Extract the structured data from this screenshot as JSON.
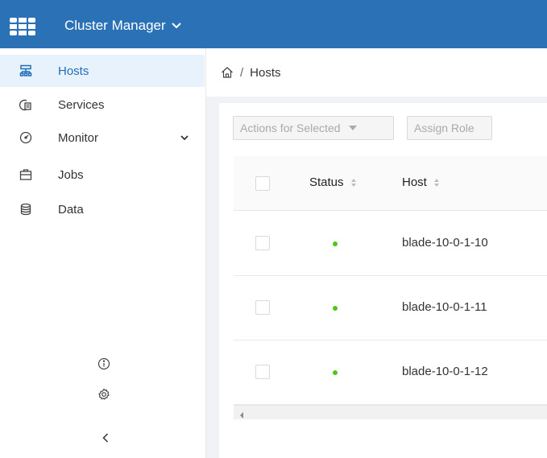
{
  "header": {
    "app_title": "Cluster Manager",
    "logo_icon": "grid-logo-icon",
    "bar_color": "#2a72b5"
  },
  "sidebar": {
    "items": [
      {
        "label": "Hosts",
        "icon": "hosts-icon",
        "active": true
      },
      {
        "label": "Services",
        "icon": "services-icon",
        "active": false
      },
      {
        "label": "Monitor",
        "icon": "monitor-icon",
        "active": false,
        "expandable": true
      },
      {
        "label": "Jobs",
        "icon": "jobs-icon",
        "active": false
      },
      {
        "label": "Data",
        "icon": "data-icon",
        "active": false
      }
    ],
    "bottom_icons": [
      "info-icon",
      "settings-icon",
      "collapse-icon"
    ]
  },
  "breadcrumb": {
    "home_icon": "home-icon",
    "separator": "/",
    "current": "Hosts"
  },
  "toolbar": {
    "actions_label": "Actions for Selected",
    "assign_label": "Assign Role"
  },
  "table": {
    "columns": [
      "Status",
      "Host"
    ],
    "rows": [
      {
        "status": "healthy",
        "host": "blade-10-0-1-10"
      },
      {
        "status": "healthy",
        "host": "blade-10-0-1-11"
      },
      {
        "status": "healthy",
        "host": "blade-10-0-1-12"
      }
    ]
  },
  "colors": {
    "accent": "#2a72b5",
    "active_bg": "#e8f2fc",
    "active_text": "#1f6fb8",
    "status_healthy": "#52c41a"
  }
}
